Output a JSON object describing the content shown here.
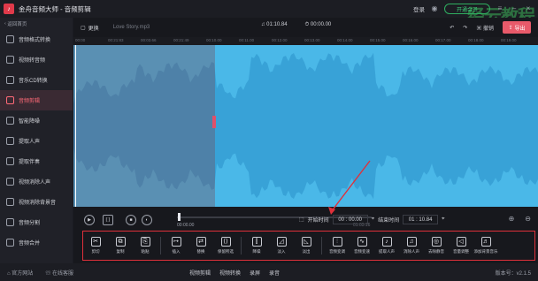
{
  "app": {
    "title": "金舟音频大师 - 音频剪辑"
  },
  "titlebar": {
    "login": "登录",
    "vip": "开通会员",
    "watermark": "经云教程"
  },
  "sidebar": {
    "back": "返回首页",
    "items": [
      {
        "label": "音频格式转换"
      },
      {
        "label": "视频转音频"
      },
      {
        "label": "音乐CD转换"
      },
      {
        "label": "音频剪辑"
      },
      {
        "label": "智能降噪"
      },
      {
        "label": "提取人声"
      },
      {
        "label": "提取伴奏"
      },
      {
        "label": "视频消除人声"
      },
      {
        "label": "视频消除背景音"
      },
      {
        "label": "音频分割"
      },
      {
        "label": "音频合并"
      }
    ]
  },
  "toolbar": {
    "replace": "更换",
    "filename": "Love Story.mp3",
    "total_duration": "01:10.84",
    "selected_duration": "00:00.00",
    "undo": "撤销",
    "export": "导出"
  },
  "ruler": {
    "ticks": [
      "00:00",
      "00:21:83",
      "00:03.66",
      "00:21:49",
      "00:10.00",
      "00:11.00",
      "00:12.00",
      "00:13.00",
      "00:14.00",
      "00:15.00",
      "00:16.00",
      "00:17.00",
      "00:18.00",
      "00:19.00"
    ]
  },
  "transport": {
    "current": "00:00.00",
    "total": "01:03.16",
    "start_label": "开始时间",
    "start_value": "00 : 00.00",
    "end_label": "结束时间",
    "end_value": "01 : 10.84"
  },
  "tools": [
    {
      "label": "剪切",
      "icon": "scissors-icon"
    },
    {
      "label": "复制",
      "icon": "copy-icon"
    },
    {
      "label": "粘贴",
      "icon": "paste-icon"
    },
    {
      "label": "插入",
      "icon": "insert-icon"
    },
    {
      "label": "替换",
      "icon": "replace-icon"
    },
    {
      "label": "保留所选",
      "icon": "keep-selection-icon"
    },
    {
      "label": "降噪",
      "icon": "noise-reduce-icon"
    },
    {
      "label": "淡入",
      "icon": "fade-in-icon"
    },
    {
      "label": "淡出",
      "icon": "fade-out-icon"
    },
    {
      "label": "音频变调",
      "icon": "pitch-icon"
    },
    {
      "label": "音频变速",
      "icon": "speed-icon"
    },
    {
      "label": "提取人声",
      "icon": "extract-vocal-icon"
    },
    {
      "label": "消除人声",
      "icon": "remove-vocal-icon"
    },
    {
      "label": "去除静音",
      "icon": "remove-silence-icon"
    },
    {
      "label": "音量调整",
      "icon": "volume-icon"
    },
    {
      "label": "添加背景音乐",
      "icon": "add-music-icon"
    }
  ],
  "statusbar": {
    "website": "官方网站",
    "support": "在线客服",
    "mid": [
      "视频剪辑",
      "视频转换",
      "录屏",
      "录音"
    ],
    "version": "版本号：v2.1.5"
  }
}
